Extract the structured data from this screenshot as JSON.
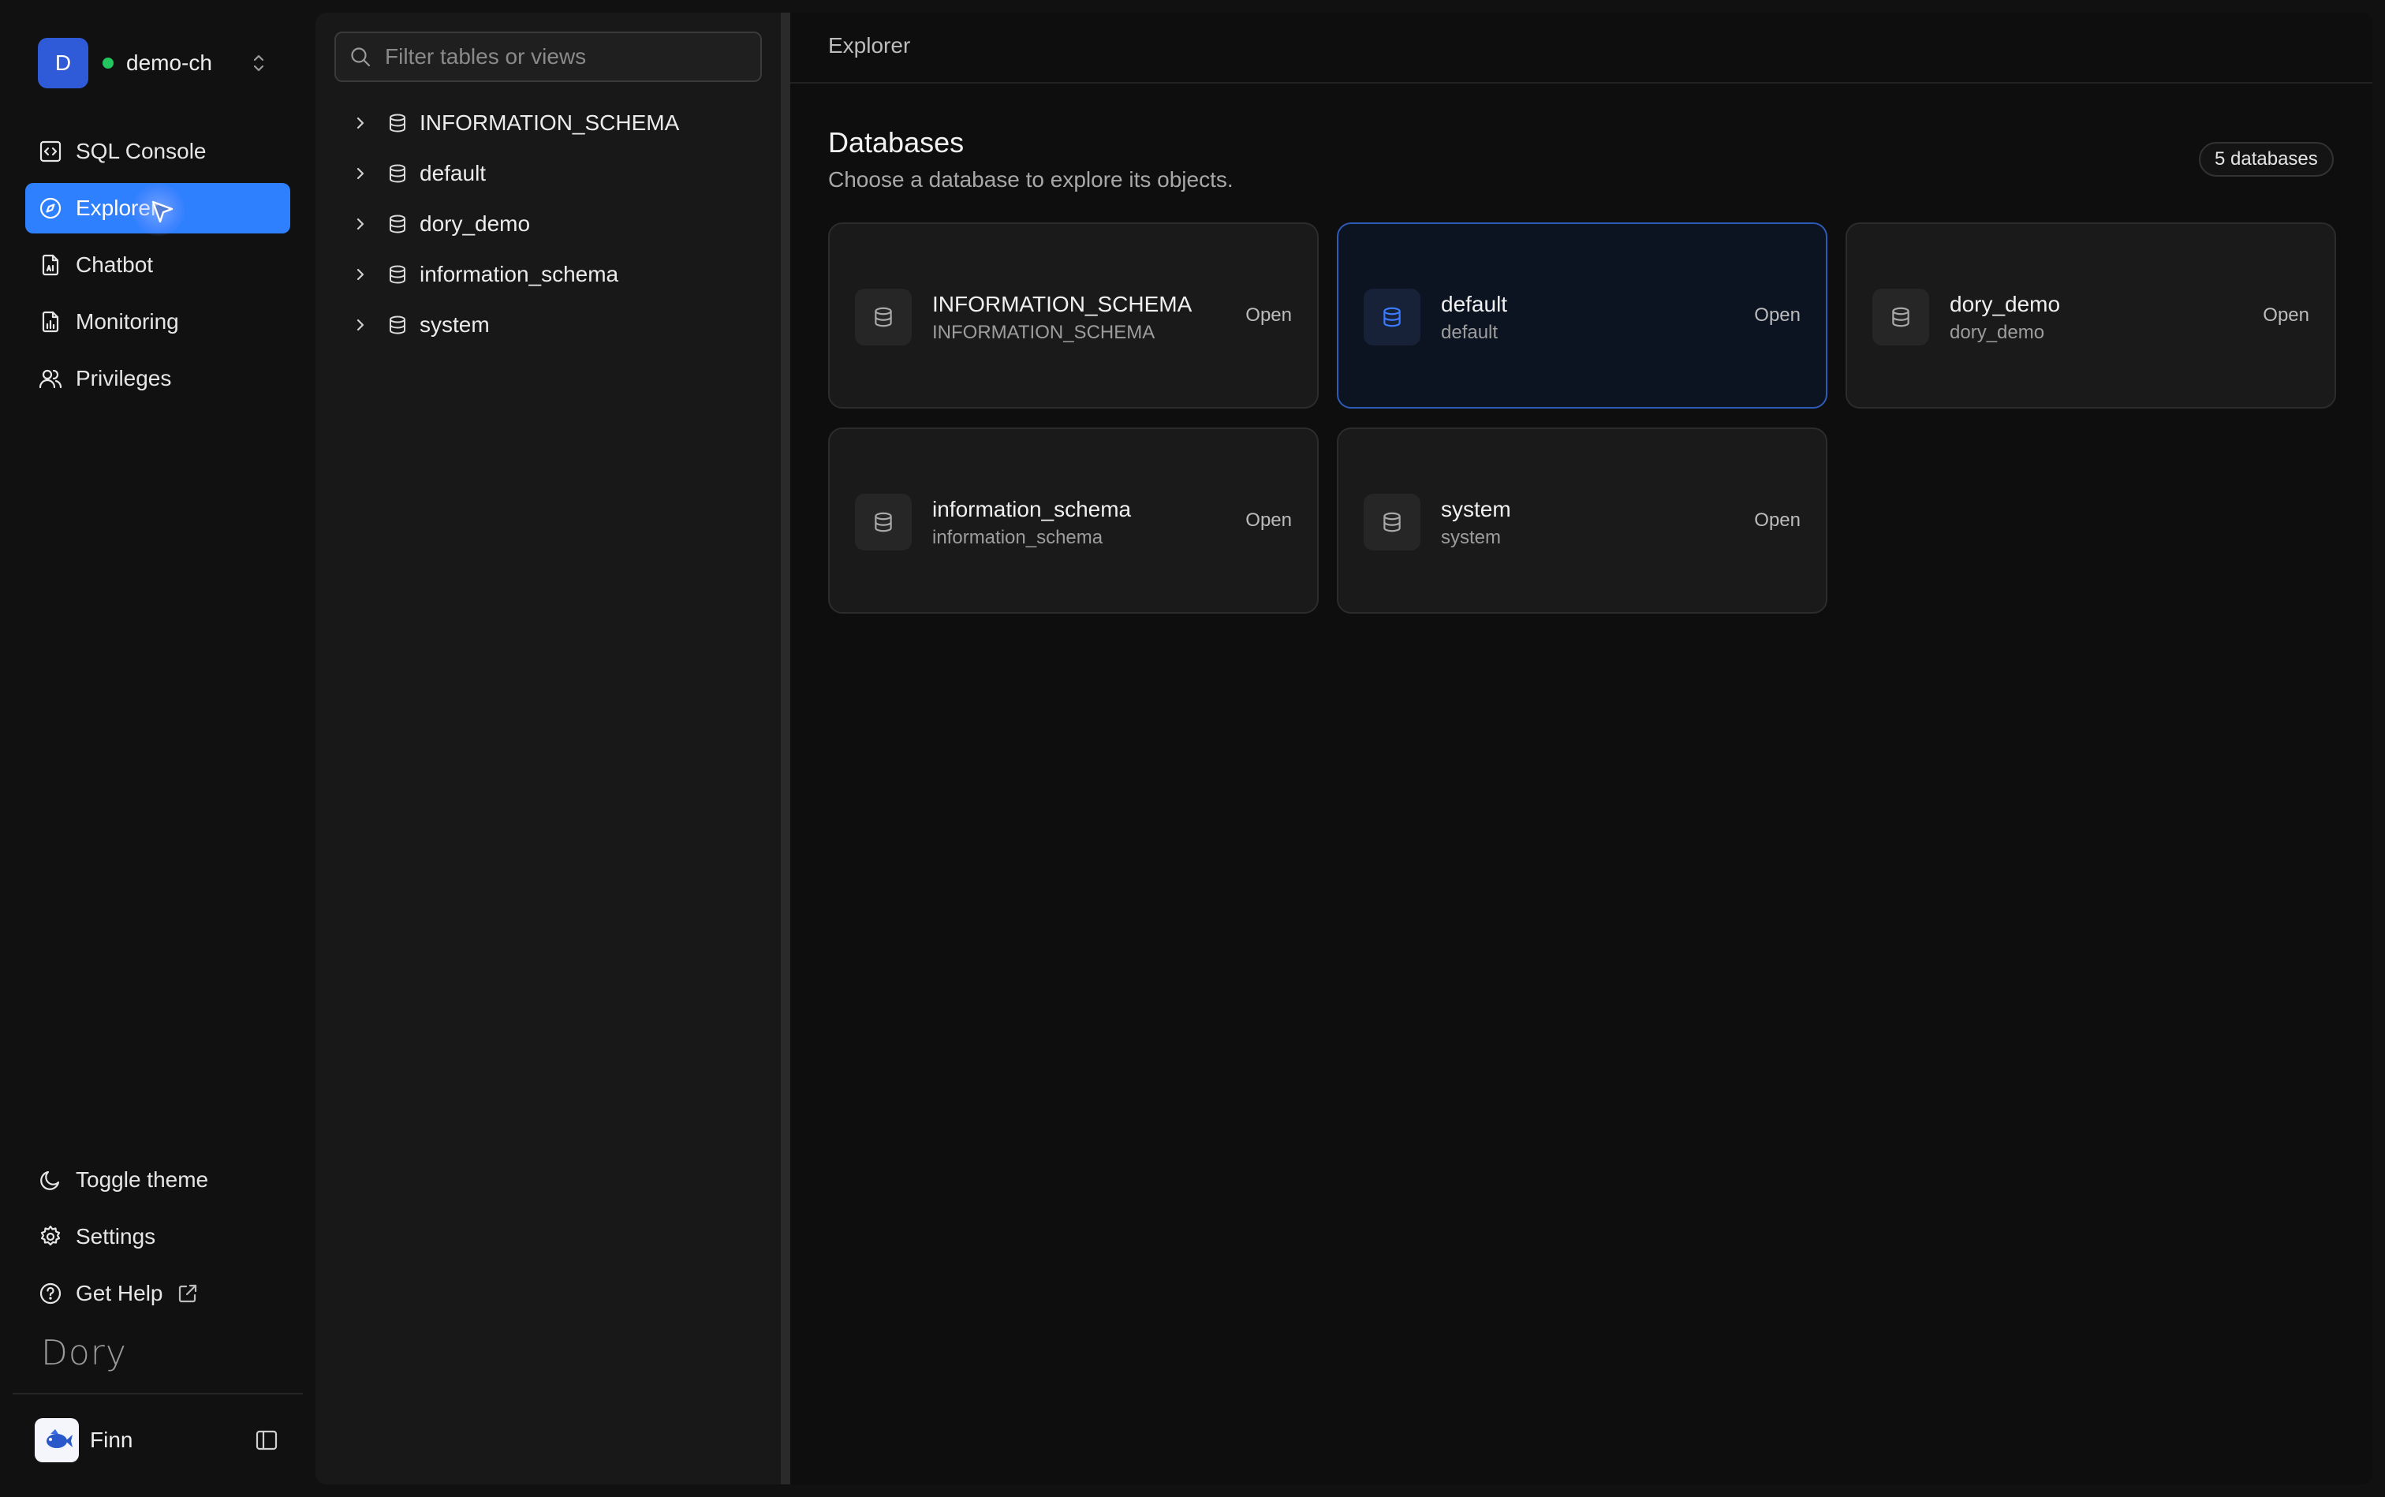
{
  "workspace": {
    "avatar_letter": "D",
    "name": "demo-ch",
    "status_color": "#22c55e"
  },
  "nav": {
    "items": [
      {
        "label": "SQL Console",
        "icon": "code-square-icon"
      },
      {
        "label": "Explorer",
        "icon": "compass-icon",
        "active": true
      },
      {
        "label": "Chatbot",
        "icon": "ai-document-icon"
      },
      {
        "label": "Monitoring",
        "icon": "chart-file-icon"
      },
      {
        "label": "Privileges",
        "icon": "users-icon"
      }
    ],
    "bottom": [
      {
        "label": "Toggle theme",
        "icon": "moon-icon"
      },
      {
        "label": "Settings",
        "icon": "gear-icon"
      },
      {
        "label": "Get Help",
        "icon": "help-circle-icon"
      }
    ],
    "brand": "Dory",
    "user": {
      "name": "Finn"
    }
  },
  "tree": {
    "filter_placeholder": "Filter tables or views",
    "items": [
      "INFORMATION_SCHEMA",
      "default",
      "dory_demo",
      "information_schema",
      "system"
    ]
  },
  "main": {
    "breadcrumb": "Explorer",
    "title": "Databases",
    "subtitle": "Choose a database to explore its objects.",
    "count_badge": "5 databases",
    "accent": "#2f80ff",
    "cards": [
      {
        "name": "INFORMATION_SCHEMA",
        "sub": "INFORMATION_SCHEMA",
        "action": "Open"
      },
      {
        "name": "default",
        "sub": "default",
        "action": "Open",
        "selected": true
      },
      {
        "name": "dory_demo",
        "sub": "dory_demo",
        "action": "Open"
      },
      {
        "name": "information_schema",
        "sub": "information_schema",
        "action": "Open"
      },
      {
        "name": "system",
        "sub": "system",
        "action": "Open"
      }
    ]
  }
}
